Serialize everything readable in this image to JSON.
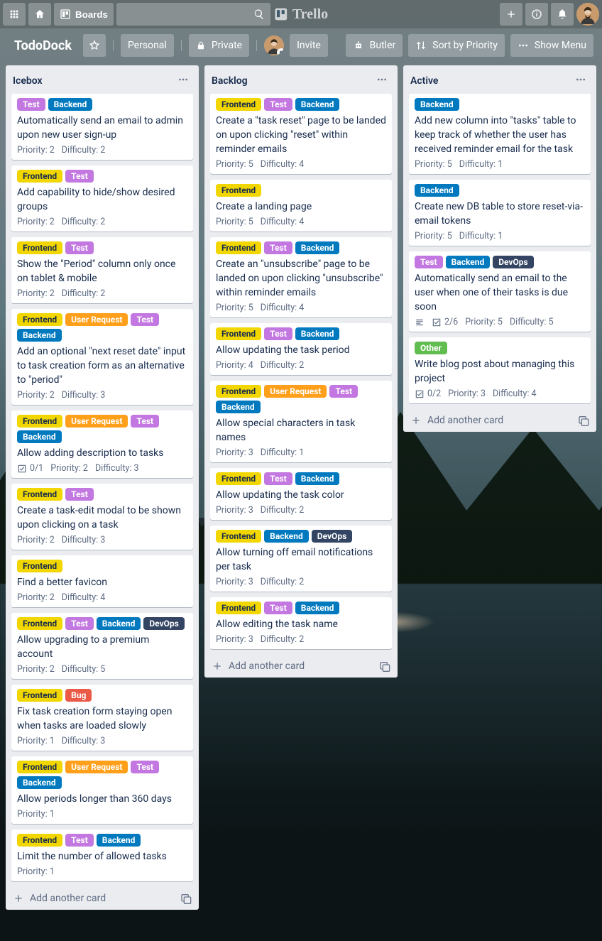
{
  "header": {
    "boards_label": "Boards",
    "search_placeholder": "",
    "logo_text": "Trello"
  },
  "board_header": {
    "board_name": "TodoDock",
    "personal": "Personal",
    "private": "Private",
    "invite": "Invite",
    "butler": "Butler",
    "sort": "Sort by Priority",
    "menu": "Show Menu"
  },
  "label_names": {
    "frontend": "Frontend",
    "test": "Test",
    "backend": "Backend",
    "userrequest": "User Request",
    "devops": "DevOps",
    "bug": "Bug",
    "other": "Other"
  },
  "add_card_label": "Add another card",
  "lists": [
    {
      "name": "Icebox",
      "cards": [
        {
          "labels": [
            "test",
            "backend"
          ],
          "title": "Automatically send an email to admin upon new user sign-up",
          "priority": 2,
          "difficulty": 2
        },
        {
          "labels": [
            "frontend",
            "test"
          ],
          "title": "Add capability to hide/show desired groups",
          "priority": 2,
          "difficulty": 2
        },
        {
          "labels": [
            "frontend",
            "test"
          ],
          "title": "Show the \"Period\" column only once on tablet & mobile",
          "priority": 2,
          "difficulty": 2
        },
        {
          "labels": [
            "frontend",
            "userrequest",
            "test",
            "backend"
          ],
          "title": "Add an optional \"next reset date\" input to task creation form as an alternative to \"period\"",
          "priority": 2,
          "difficulty": 3
        },
        {
          "labels": [
            "frontend",
            "userrequest",
            "test",
            "backend"
          ],
          "title": "Allow adding description to tasks",
          "checklist": "0/1",
          "priority": 2,
          "difficulty": 3
        },
        {
          "labels": [
            "frontend",
            "test"
          ],
          "title": "Create a task-edit modal to be shown upon clicking on a task",
          "priority": 2,
          "difficulty": 3
        },
        {
          "labels": [
            "frontend"
          ],
          "title": "Find a better favicon",
          "priority": 2,
          "difficulty": 4
        },
        {
          "labels": [
            "frontend",
            "test",
            "backend",
            "devops"
          ],
          "title": "Allow upgrading to a premium account",
          "priority": 2,
          "difficulty": 5
        },
        {
          "labels": [
            "frontend",
            "bug"
          ],
          "title": "Fix task creation form staying open when tasks are loaded slowly",
          "priority": 1,
          "difficulty": 3
        },
        {
          "labels": [
            "frontend",
            "userrequest",
            "test",
            "backend"
          ],
          "title": "Allow periods longer than 360 days",
          "priority": 1
        },
        {
          "labels": [
            "frontend",
            "test",
            "backend"
          ],
          "title": "Limit the number of allowed tasks",
          "priority": 1
        }
      ]
    },
    {
      "name": "Backlog",
      "cards": [
        {
          "labels": [
            "frontend",
            "test",
            "backend"
          ],
          "title": "Create a \"task reset\" page to be landed on upon clicking \"reset\" within reminder emails",
          "priority": 5,
          "difficulty": 4
        },
        {
          "labels": [
            "frontend"
          ],
          "title": "Create a landing page",
          "priority": 5,
          "difficulty": 4
        },
        {
          "labels": [
            "frontend",
            "test",
            "backend"
          ],
          "title": "Create an \"unsubscribe\" page to be landed on upon clicking \"unsubscribe\" within reminder emails",
          "priority": 5,
          "difficulty": 4
        },
        {
          "labels": [
            "frontend",
            "test",
            "backend"
          ],
          "title": "Allow updating the task period",
          "priority": 4,
          "difficulty": 2
        },
        {
          "labels": [
            "frontend",
            "userrequest",
            "test",
            "backend"
          ],
          "title": "Allow special characters in task names",
          "priority": 3,
          "difficulty": 1
        },
        {
          "labels": [
            "frontend",
            "test",
            "backend"
          ],
          "title": "Allow updating the task color",
          "priority": 3,
          "difficulty": 2
        },
        {
          "labels": [
            "frontend",
            "backend",
            "devops"
          ],
          "title": "Allow turning off email notifications per task",
          "priority": 3,
          "difficulty": 2
        },
        {
          "labels": [
            "frontend",
            "test",
            "backend"
          ],
          "title": "Allow editing the task name",
          "priority": 3,
          "difficulty": 2
        }
      ]
    },
    {
      "name": "Active",
      "cards": [
        {
          "labels": [
            "backend"
          ],
          "title": "Add new column into \"tasks\" table to keep track of whether the user has received reminder email for the task",
          "priority": 5,
          "difficulty": 1
        },
        {
          "labels": [
            "backend"
          ],
          "title": "Create new DB table to store reset-via-email tokens",
          "priority": 5,
          "difficulty": 1
        },
        {
          "labels": [
            "test",
            "backend",
            "devops"
          ],
          "title": "Automatically send an email to the user when one of their tasks is due soon",
          "description": true,
          "checklist": "2/6",
          "priority": 5,
          "difficulty": 5
        },
        {
          "labels": [
            "other"
          ],
          "title": "Write blog post about managing this project",
          "checklist": "0/2",
          "priority": 3,
          "difficulty": 4
        }
      ]
    }
  ]
}
